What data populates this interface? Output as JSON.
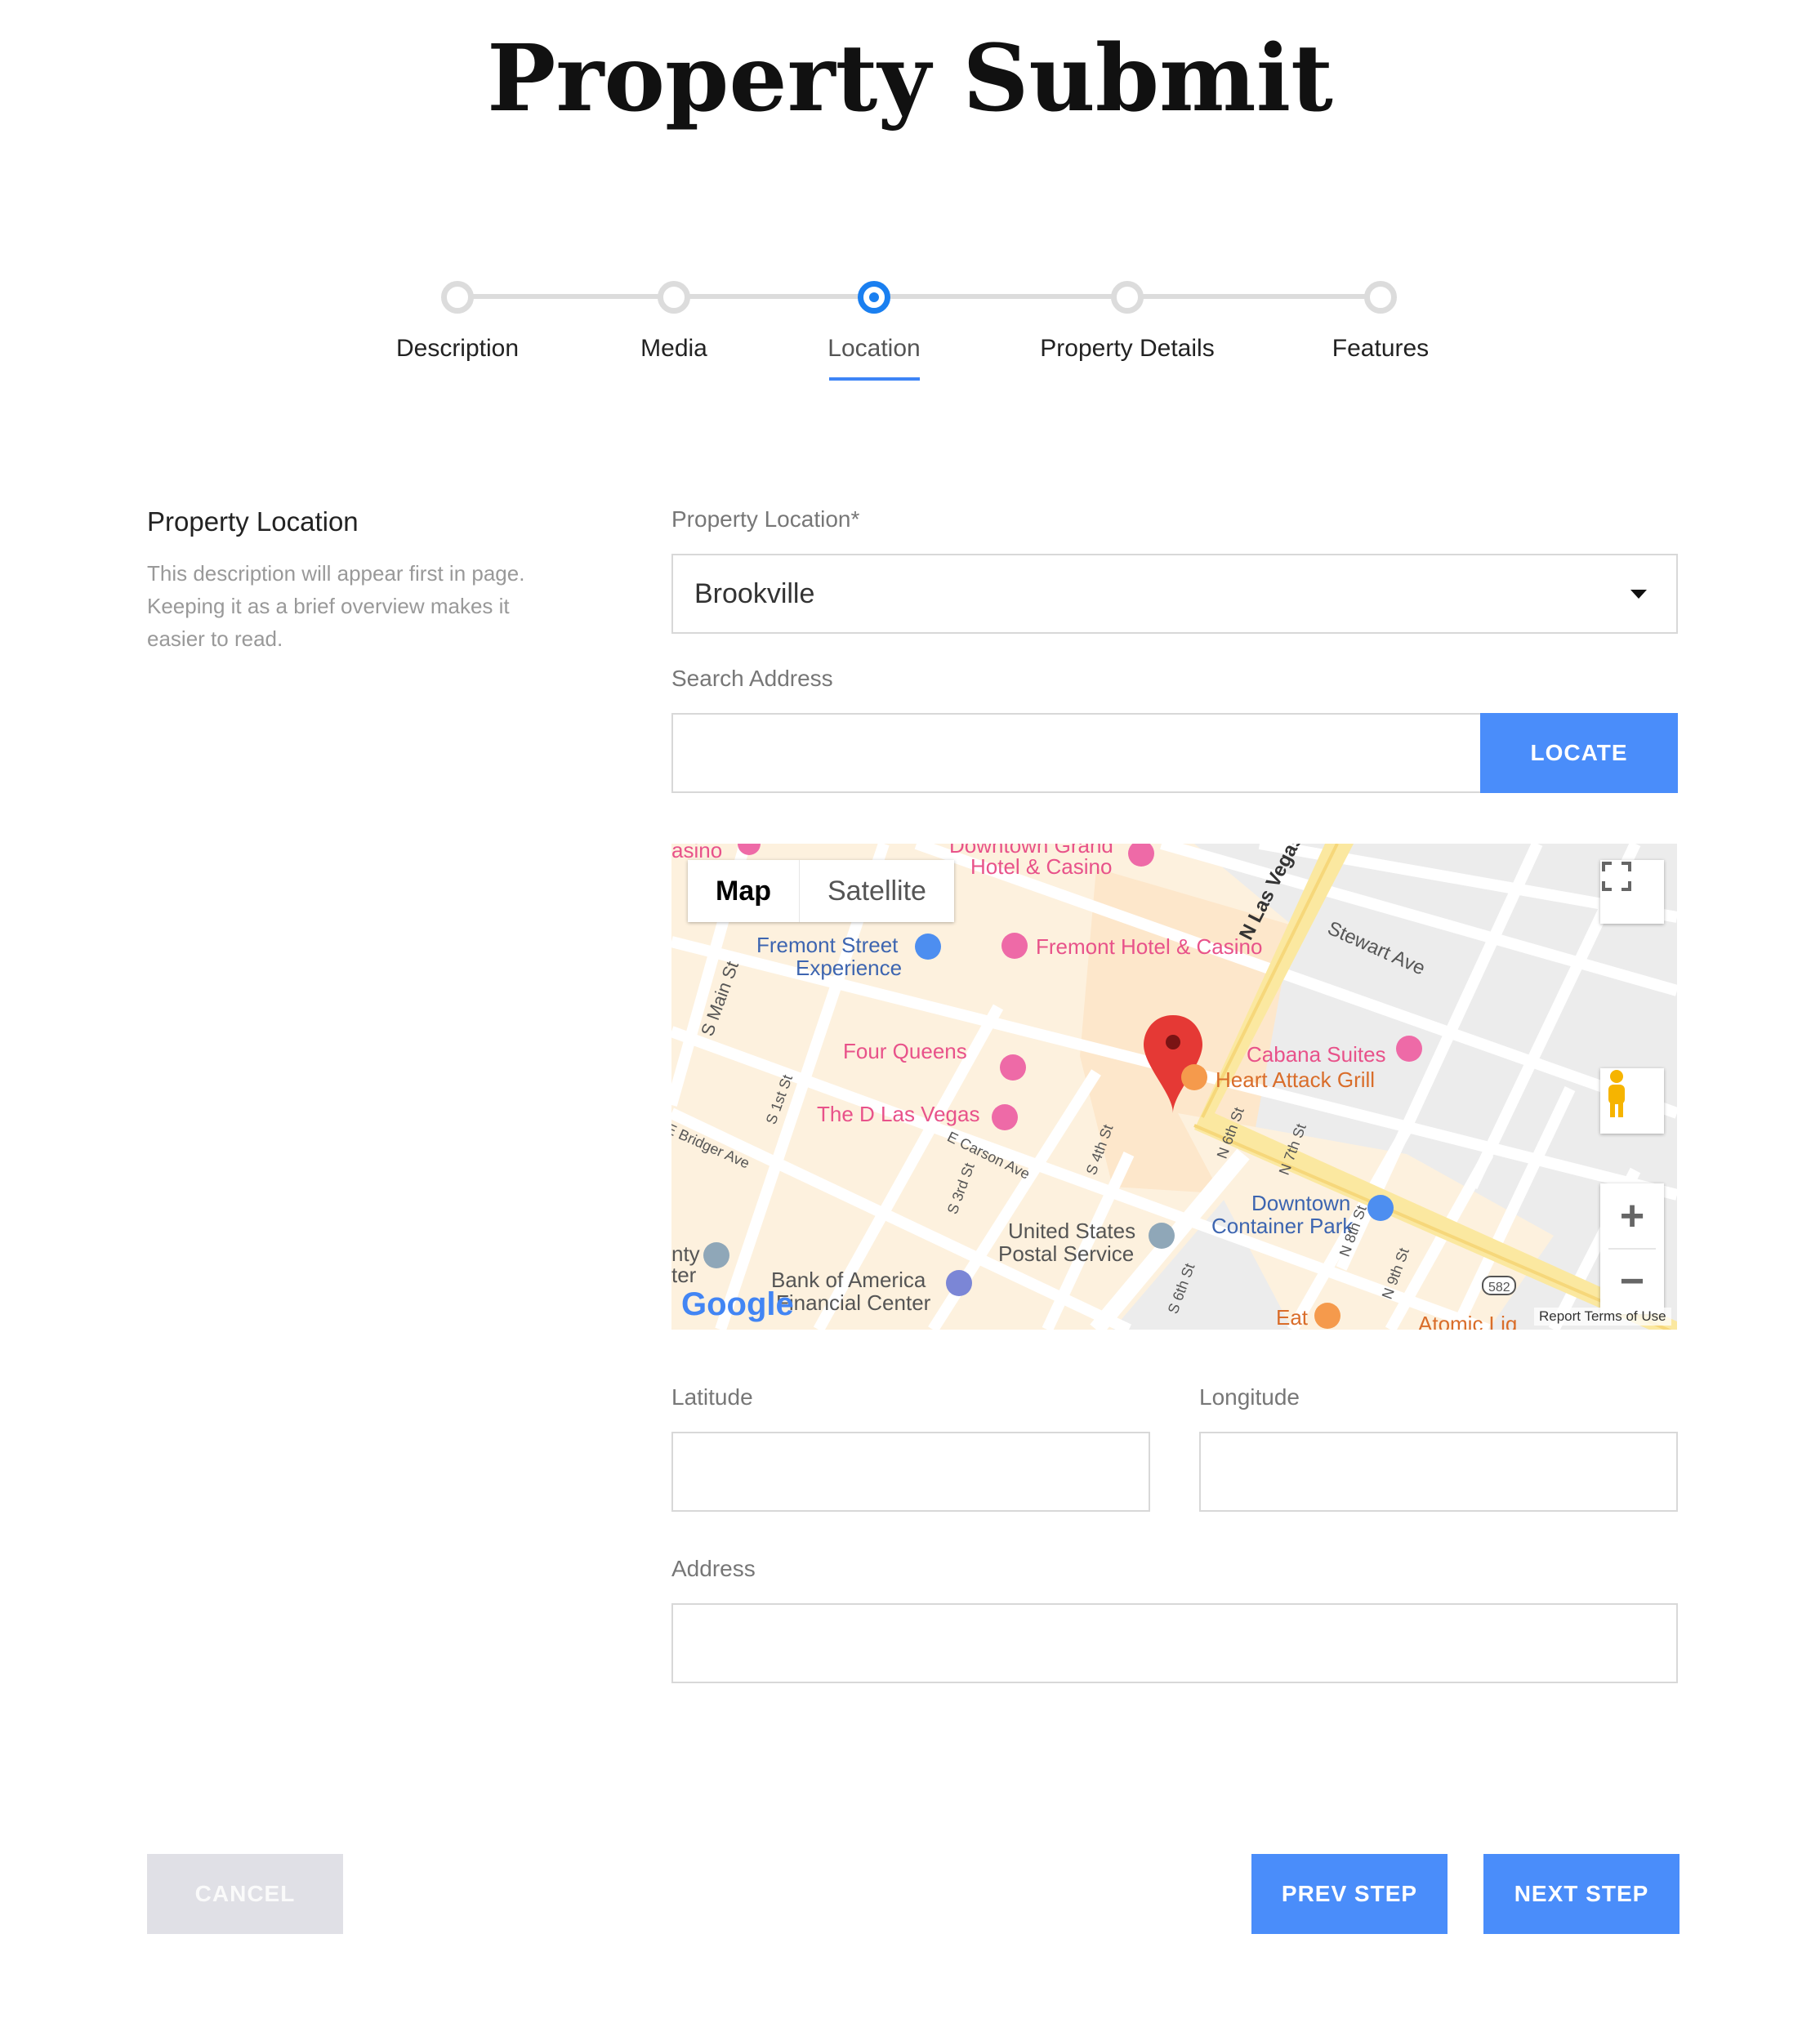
{
  "page": {
    "title": "Property Submit"
  },
  "stepper": {
    "steps": [
      {
        "label": "Description",
        "active": false
      },
      {
        "label": "Media",
        "active": false
      },
      {
        "label": "Location",
        "active": true
      },
      {
        "label": "Property Details",
        "active": false
      },
      {
        "label": "Features",
        "active": false
      }
    ]
  },
  "section": {
    "title": "Property Location",
    "description": "This description will appear first in page. Keeping it as a brief overview makes it easier to read."
  },
  "form": {
    "location": {
      "label": "Property Location*",
      "value": "Brookville"
    },
    "search": {
      "label": "Search Address",
      "value": "",
      "button_label": "LOCATE"
    },
    "latitude": {
      "label": "Latitude",
      "value": ""
    },
    "longitude": {
      "label": "Longitude",
      "value": ""
    },
    "address": {
      "label": "Address",
      "value": ""
    }
  },
  "map": {
    "type_map": "Map",
    "type_satellite": "Satellite",
    "google": "Google",
    "footer": "Report Terms of Use",
    "labels": {
      "casino": "asino",
      "downtown_grand": "Downtown Grand",
      "hotel_casino": "Hotel & Casino",
      "fremont_street": "Fremont Street",
      "experience": "Experience",
      "fremont_hotel": "Fremont Hotel & Casino",
      "four_queens": "Four Queens",
      "the_d": "The D Las Vegas",
      "cabana": "Cabana Suites",
      "heart_attack": "Heart Attack Grill",
      "downtown": "Downtown",
      "container_park": "Container Park",
      "usps_1": "United States",
      "usps_2": "Postal Service",
      "boa_1": "Bank of America",
      "boa_2": "Financial Center",
      "eat": "Eat",
      "atomic": "Atomic Liq",
      "n_las_vegas": "N Las Vegas Blvd",
      "stewart": "Stewart Ave",
      "s_main": "S Main St",
      "bridger": "E Bridger Ave",
      "carson": "E Carson Ave",
      "s1": "S 1st St",
      "s3": "S 3rd St",
      "s4": "S 4th St",
      "n6": "N 6th St",
      "n7": "N 7th St",
      "n8": "N 8th St",
      "n9": "N 9th St",
      "s6": "S 6th St",
      "route": "582",
      "county_1": "nty",
      "county_2": "ter"
    }
  },
  "actions": {
    "cancel": "CANCEL",
    "prev": "PREV STEP",
    "next": "NEXT STEP"
  },
  "colors": {
    "accent": "#4a8dfa",
    "active_step": "#1a7ff0",
    "pin": "#e53935"
  }
}
